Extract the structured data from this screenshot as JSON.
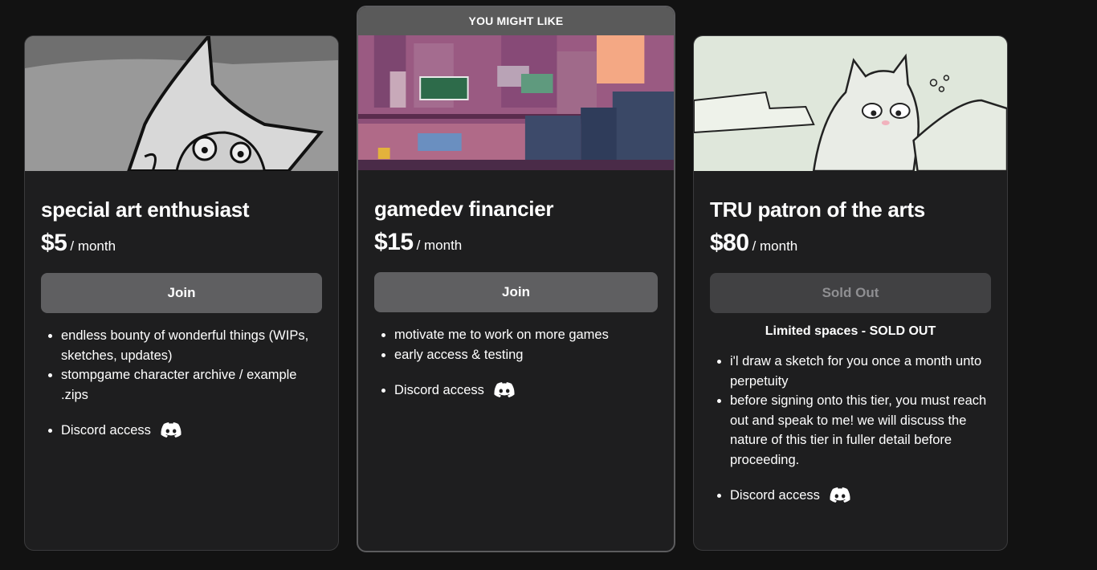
{
  "featured_label": "YOU MIGHT LIKE",
  "tiers": [
    {
      "name": "special art enthusiast",
      "price": "$5",
      "period": "/ month",
      "button_label": "Join",
      "perks": [
        "endless bounty of wonderful things (WIPs, sketches, updates)",
        "stompgame character archive / example .zips"
      ],
      "discord": "Discord access"
    },
    {
      "name": "gamedev financier",
      "price": "$15",
      "period": "/ month",
      "button_label": "Join",
      "perks": [
        "motivate me to work on more games",
        "early access & testing"
      ],
      "discord": "Discord access"
    },
    {
      "name": "TRU patron of the arts",
      "price": "$80",
      "period": "/ month",
      "button_label": "Sold Out",
      "limited_note": "Limited spaces - SOLD OUT",
      "perks": [
        "i'l draw a sketch for you once a month unto perpetuity",
        "before signing onto this tier, you must reach out and speak to me! we will discuss the nature of this tier in fuller detail before proceeding."
      ],
      "discord": "Discord access"
    }
  ],
  "colors": {
    "background": "#121212",
    "card": "#1e1e1f",
    "button": "#5f5f61",
    "button_disabled": "#414143",
    "banner": "#5a5a5a"
  },
  "icons": [
    "discord-icon"
  ]
}
